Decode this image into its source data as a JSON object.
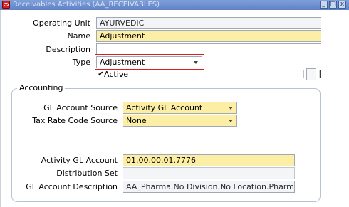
{
  "window": {
    "title": "Receivables Activities (AA_RECEIVABLES)",
    "controls": {
      "minimize": "_",
      "maximize": "□",
      "close": "x"
    }
  },
  "form": {
    "operating_unit": {
      "label": "Operating Unit",
      "value": "AYURVEDIC"
    },
    "name": {
      "label": "Name",
      "value": "Adjustment"
    },
    "description": {
      "label": "Description",
      "value": ""
    },
    "type": {
      "label": "Type",
      "value": "Adjustment"
    },
    "active": {
      "label": "Active",
      "checked": true,
      "checkmark": "✔"
    },
    "flex": {
      "left_bracket": "[",
      "right_bracket": "]"
    }
  },
  "accounting": {
    "section_title": "Accounting",
    "gl_account_source": {
      "label": "GL Account Source",
      "value": "Activity GL Account"
    },
    "tax_rate_code_source": {
      "label": "Tax Rate Code Source",
      "value": "None"
    },
    "activity_gl_account": {
      "label": "Activity GL Account",
      "value": "01.00.00.01.7776"
    },
    "distribution_set": {
      "label": "Distribution Set",
      "value": ""
    },
    "gl_account_description": {
      "label": "GL Account Description",
      "value": "AA_Pharma.No Division.No Location.Pharma.Adjustm"
    }
  },
  "colors": {
    "title_bar": "#6b8fd0",
    "required_field": "#fcefa5",
    "focus_border": "#d82020",
    "field_border": "#9fa8b4"
  },
  "icons": {
    "app": "oracle-logo-icon",
    "dropdown": "chevron-down-icon"
  }
}
